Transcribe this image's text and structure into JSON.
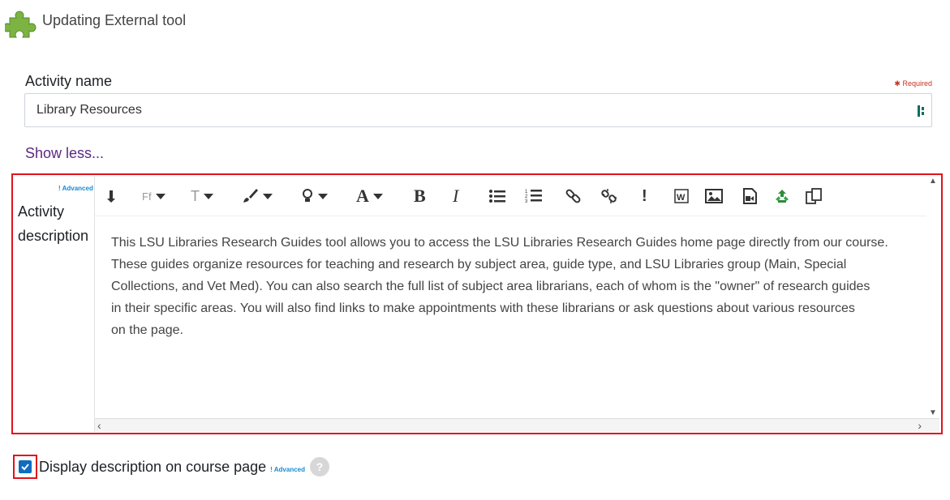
{
  "header": {
    "title": "Updating External tool",
    "icon": "puzzle-piece-icon"
  },
  "name_field": {
    "label": "Activity name",
    "required_text": "Required",
    "value": "Library Resources"
  },
  "show_less": "Show less...",
  "description": {
    "advanced_badge": "! Advanced",
    "label_line1": "Activity",
    "label_line2": "description",
    "toolbar": [
      "paragraph-icon",
      "font-family-icon",
      "font-size-icon",
      "paint-brush-icon",
      "lightbulb-icon",
      "font-color-icon",
      "bold-icon",
      "italic-icon",
      "bullet-list-icon",
      "numbered-list-icon",
      "link-icon",
      "unlink-icon",
      "exclamation-icon",
      "word-paste-icon",
      "image-icon",
      "media-icon",
      "recycle-icon",
      "copy-icon"
    ],
    "toolbar_labels": {
      "font_family": "Ff",
      "font_size": "T",
      "font_color": "A",
      "bold": "B",
      "italic": "I",
      "exclamation": "!"
    },
    "lines": [
      "This LSU Libraries Research Guides tool allows you to access the LSU Libraries Research Guides home page directly from our course.",
      "These guides organize resources for teaching and research by subject area, guide type, and LSU Libraries group (Main, Special",
      "Collections, and Vet Med). You can also search the full list of subject area librarians, each of whom is the \"owner\" of research guides",
      "in their specific areas. You will also find links to make appointments with these librarians or ask questions about various resources",
      "on the page."
    ]
  },
  "display_checkbox": {
    "label": "Display description on course page",
    "checked": true,
    "advanced_badge": "! Advanced",
    "help": "?"
  },
  "colors": {
    "required": "#ca3120",
    "link": "#5a2a82",
    "highlight": "#e0131b",
    "checkbox": "#0f6cbf",
    "badge": "#1a8ad1"
  }
}
